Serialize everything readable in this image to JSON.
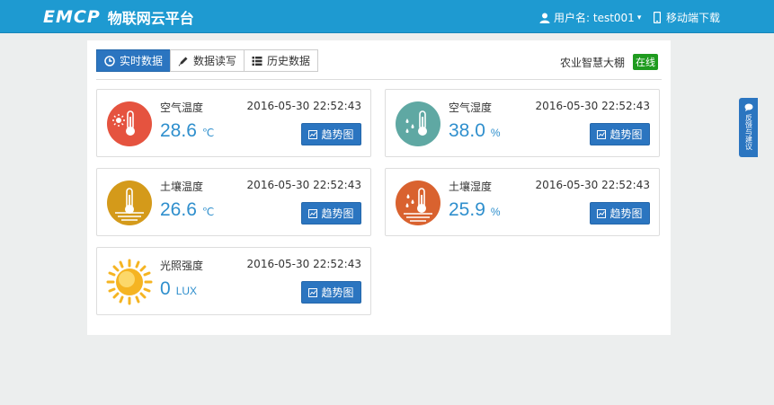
{
  "header": {
    "logo_mark": "EMCP",
    "platform_name": "物联网云平台",
    "user_label": "用户名: test001",
    "user_caret": "▾",
    "mobile_label": "移动端下载"
  },
  "tabs": [
    {
      "label": "实时数据",
      "active": true,
      "icon": "clock-icon"
    },
    {
      "label": "数据读写",
      "active": false,
      "icon": "pencil-icon"
    },
    {
      "label": "历史数据",
      "active": false,
      "icon": "list-icon"
    }
  ],
  "device": {
    "name": "农业智慧大棚",
    "status": "在线"
  },
  "cards": [
    {
      "label": "空气温度",
      "time": "2016-05-30 22:52:43",
      "value": "28.6",
      "unit": "℃",
      "button": "趋势图",
      "icon": "air-temperature-icon",
      "color": "#e5533f"
    },
    {
      "label": "空气湿度",
      "time": "2016-05-30 22:52:43",
      "value": "38.0",
      "unit": "%",
      "button": "趋势图",
      "icon": "air-humidity-icon",
      "color": "#5fa8a3"
    },
    {
      "label": "土壤温度",
      "time": "2016-05-30 22:52:43",
      "value": "26.6",
      "unit": "℃",
      "button": "趋势图",
      "icon": "soil-temperature-icon",
      "color": "#d49a1a"
    },
    {
      "label": "土壤湿度",
      "time": "2016-05-30 22:52:43",
      "value": "25.9",
      "unit": "%",
      "button": "趋势图",
      "icon": "soil-humidity-icon",
      "color": "#d9622f"
    },
    {
      "label": "光照强度",
      "time": "2016-05-30 22:52:43",
      "value": "0",
      "unit": "LUX",
      "button": "趋势图",
      "icon": "sun-icon",
      "color": "#f5b422"
    }
  ],
  "feedback": {
    "label": "反馈与建议"
  },
  "colors": {
    "topbar": "#1e9ad1",
    "primary_button": "#2b75c0",
    "value_text": "#2f8fcd",
    "online_badge": "#1f9b1f"
  }
}
